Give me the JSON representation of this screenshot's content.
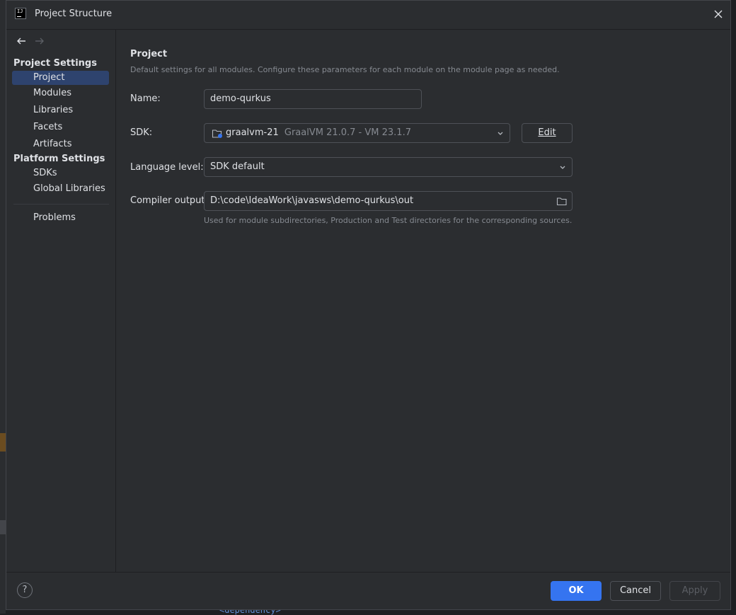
{
  "dialog": {
    "title": "Project Structure"
  },
  "sidebar": {
    "project_settings_header": "Project Settings",
    "project_settings_items": [
      "Project",
      "Modules",
      "Libraries",
      "Facets",
      "Artifacts"
    ],
    "platform_settings_header": "Platform Settings",
    "platform_settings_items": [
      "SDKs",
      "Global Libraries"
    ],
    "other_items": [
      "Problems"
    ],
    "selected": "Project"
  },
  "main": {
    "title": "Project",
    "description": "Default settings for all modules. Configure these parameters for each module on the module page as needed.",
    "name_label": "Name:",
    "name_value": "demo-qurkus",
    "sdk_label": "SDK:",
    "sdk_name": "graalvm-21",
    "sdk_version": "GraalVM 21.0.7 - VM 23.1.7",
    "edit_button": "Edit",
    "language_label": "Language level:",
    "language_value": "SDK default",
    "compiler_label": "Compiler output:",
    "compiler_value": "D:\\code\\IdeaWork\\javasws\\demo-qurkus\\out",
    "compiler_hint": "Used for module subdirectories, Production and Test directories for the corresponding sources."
  },
  "footer": {
    "help": "?",
    "ok": "OK",
    "cancel": "Cancel",
    "apply": "Apply"
  },
  "background": {
    "editor_text": "<dependency>"
  },
  "colors": {
    "accent": "#3574f0",
    "selection": "#2e436e",
    "dialog_bg": "#2b2d30"
  }
}
